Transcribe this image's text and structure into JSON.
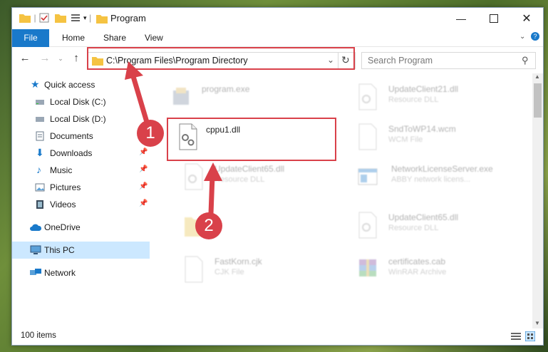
{
  "window": {
    "title": "Program"
  },
  "ribbon": {
    "tabs": [
      "File",
      "Home",
      "Share",
      "View"
    ]
  },
  "address": {
    "path": "C:\\Program Files\\Program Directory"
  },
  "search": {
    "placeholder": "Search Program"
  },
  "sidebar": {
    "items": [
      {
        "label": "Quick access",
        "icon": "star-icon",
        "pinned": false
      },
      {
        "label": "Local Disk (C:)",
        "icon": "drive-icon",
        "pinned": false
      },
      {
        "label": "Local Disk (D:)",
        "icon": "drive-icon",
        "pinned": false
      },
      {
        "label": "Documents",
        "icon": "documents-icon",
        "pinned": false
      },
      {
        "label": "Downloads",
        "icon": "downloads-icon",
        "pinned": true
      },
      {
        "label": "Music",
        "icon": "music-icon",
        "pinned": true
      },
      {
        "label": "Pictures",
        "icon": "pictures-icon",
        "pinned": true
      },
      {
        "label": "Videos",
        "icon": "videos-icon",
        "pinned": true
      },
      {
        "label": "OneDrive",
        "icon": "cloud-icon",
        "pinned": false
      },
      {
        "label": "This PC",
        "icon": "computer-icon",
        "pinned": false,
        "selected": true
      },
      {
        "label": "Network",
        "icon": "network-icon",
        "pinned": false
      }
    ]
  },
  "files": [
    {
      "name": "program.exe",
      "type": "",
      "icon": "exe-icon"
    },
    {
      "name": "UpdateClient21.dll",
      "type": "Resource DLL",
      "icon": "dll-icon"
    },
    {
      "name": "cppu1.dll",
      "type": "",
      "icon": "gear-file-icon"
    },
    {
      "name": "SndToWP14.wcm",
      "type": "WCM File",
      "icon": "file-icon"
    },
    {
      "name": "UpdateClient65.dll",
      "type": "Resource DLL",
      "icon": "dll-icon"
    },
    {
      "name": "NetworkLicenseServer.exe",
      "type": "ABBY network licens...",
      "icon": "exe-window-icon"
    },
    {
      "name": "",
      "type": "",
      "icon": "folder-icon"
    },
    {
      "name": "UpdateClient65.dll",
      "type": "Resource DLL",
      "icon": "dll-icon"
    },
    {
      "name": "FastKorn.cjk",
      "type": "CJK File",
      "icon": "file-icon"
    },
    {
      "name": "certificates.cab",
      "type": "WinRAR Archive",
      "icon": "archive-icon"
    }
  ],
  "status": {
    "item_count": "100 items"
  },
  "annotations": {
    "step1": "1",
    "step2": "2"
  },
  "colors": {
    "accent": "#1979ca",
    "highlight": "#d9414a",
    "selected": "#cce8ff"
  }
}
